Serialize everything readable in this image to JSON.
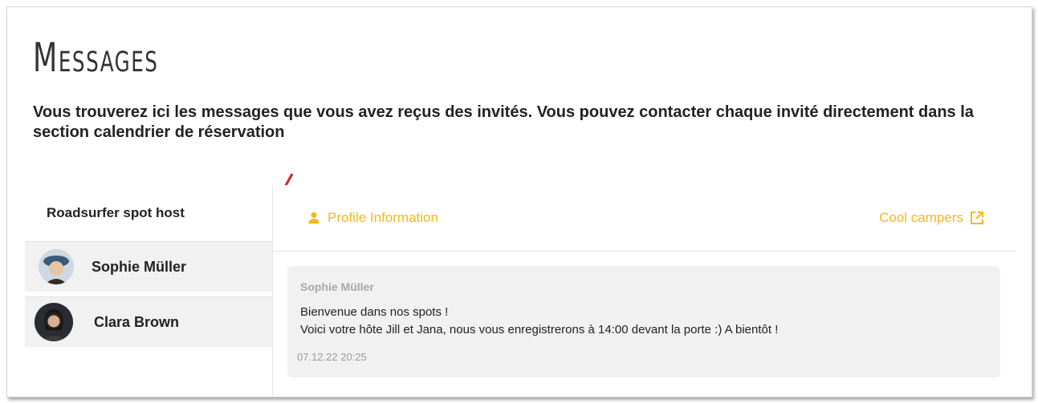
{
  "page": {
    "title": "Messages",
    "subtitle": "Vous trouverez ici les messages que vous avez reçus des invités. Vous pouvez contacter chaque invité directement dans la section calendrier de réservation"
  },
  "sidebar": {
    "header": "Roadsurfer spot host",
    "contacts": [
      {
        "name": "Sophie Müller"
      },
      {
        "name": "Clara Brown"
      }
    ]
  },
  "main": {
    "profile_link": "Profile Information",
    "camper_link": "Cool campers",
    "accent_color": "#f5b820"
  },
  "message": {
    "sender": "Sophie Müller",
    "line1": "Bienvenue dans nos spots !",
    "line2": "Voici votre hôte Jill et Jana, nous vous enregistrerons à 14:00 devant la porte :)  A bientôt !",
    "timestamp": "07.12.22 20:25"
  },
  "icons": {
    "profile": "person-icon",
    "external": "external-link-icon",
    "annotation": "red-arrow"
  }
}
